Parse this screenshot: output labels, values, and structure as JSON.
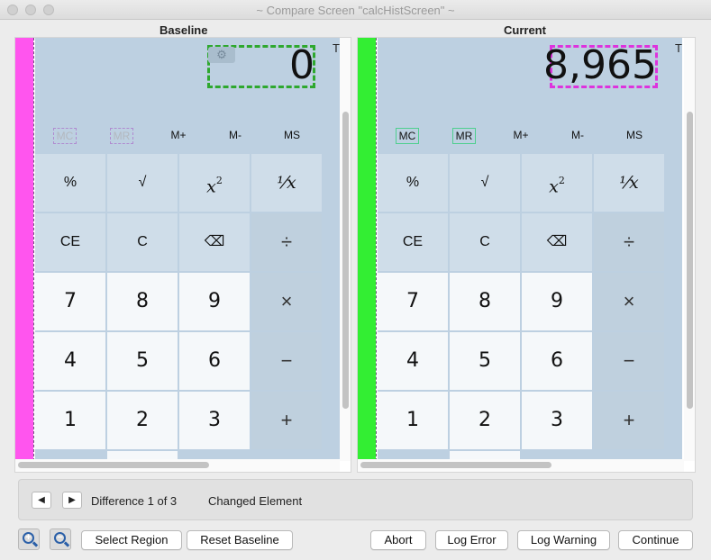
{
  "window": {
    "title": "~ Compare Screen \"calcHistScreen\" ~"
  },
  "colors": {
    "baseline_stripe": "#ff55ee",
    "current_stripe": "#33ee33",
    "baseline_box": "#2ea82e",
    "current_box": "#dd33dd"
  },
  "baseline": {
    "label": "Baseline",
    "display": "0",
    "t_mark": "T",
    "gear_icon": "gear-icon",
    "memory": [
      "MC",
      "MR",
      "M+",
      "M-",
      "MS"
    ]
  },
  "current": {
    "label": "Current",
    "display": "8,965",
    "t_mark": "T",
    "memory": [
      "MC",
      "MR",
      "M+",
      "M-",
      "MS"
    ]
  },
  "keys": {
    "percent": "%",
    "sqrt": "√",
    "square": "x",
    "square_exp": "2",
    "reciprocal": "⅟x",
    "ce": "CE",
    "c": "C",
    "backspace": "⌫",
    "divide": "÷",
    "seven": "7",
    "eight": "8",
    "nine": "9",
    "multiply": "×",
    "four": "4",
    "five": "5",
    "six": "6",
    "minus": "−",
    "one": "1",
    "two": "2",
    "three": "3",
    "plus": "+"
  },
  "diff": {
    "prev_icon": "◀",
    "next_icon": "▶",
    "counter": "Difference 1 of 3",
    "type": "Changed Element"
  },
  "buttons": {
    "zoom_in": "zoom-in-icon",
    "zoom_out": "zoom-out-icon",
    "select_region": "Select Region",
    "reset_baseline": "Reset Baseline",
    "abort": "Abort",
    "log_error": "Log Error",
    "log_warning": "Log Warning",
    "continue": "Continue"
  }
}
